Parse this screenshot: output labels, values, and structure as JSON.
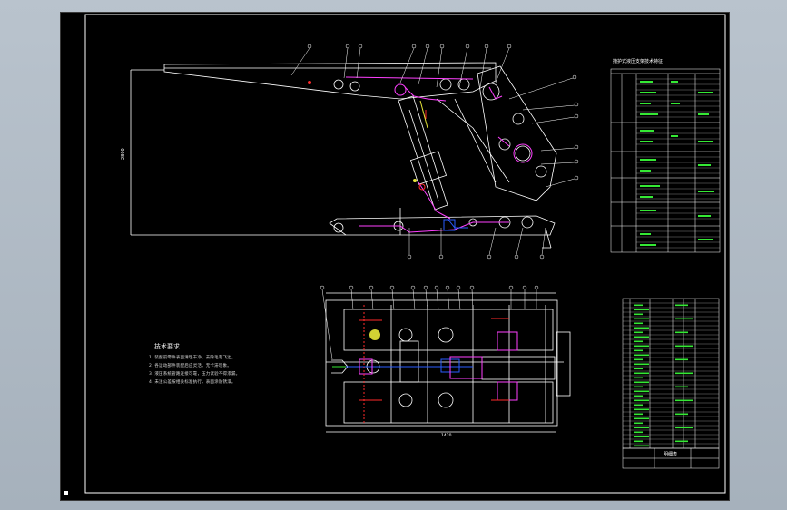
{
  "drawing": {
    "title_block_top": "掩护式液压支架技术特征",
    "tech_requirements_title": "技术要求",
    "tech_requirements_lines": [
      "1. 装配前零件表面清理干净，去除毛刺飞边。",
      "2. 各运动部件装配后应灵活，无卡滞现象。",
      "3. 液压系统管路连接可靠，压力试验不得渗漏。",
      "4. 未注公差按相关标准执行，表面涂防锈漆。"
    ],
    "bottom_table_title": "明细表",
    "colors": {
      "line_white": "#ffffff",
      "line_magenta": "#ff40ff",
      "line_blue": "#2a5cff",
      "line_red": "#ff2a2a",
      "line_green": "#34e834",
      "line_yellow": "#e8e83a",
      "background": "#000000"
    }
  }
}
